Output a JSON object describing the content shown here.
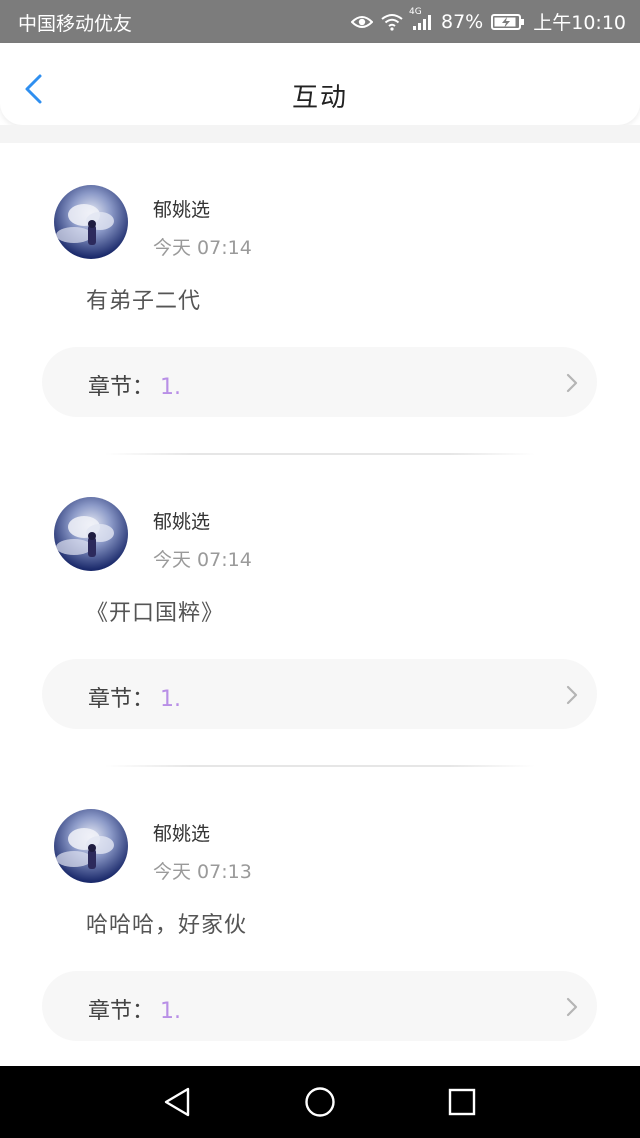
{
  "status_bar": {
    "carrier": "中国移动优友",
    "network": "4G",
    "battery": "87%",
    "time": "上午10:10"
  },
  "header": {
    "title": "互动",
    "back_icon": "chevron-left-icon"
  },
  "posts": [
    {
      "username": "郁姚选",
      "time": "今天 07:14",
      "content": "有弟子二代",
      "chapter_label": "章节：",
      "chapter_value": "1."
    },
    {
      "username": "郁姚选",
      "time": "今天 07:14",
      "content": "《开口国粹》",
      "chapter_label": "章节：",
      "chapter_value": "1."
    },
    {
      "username": "郁姚选",
      "time": "今天 07:13",
      "content": "哈哈哈，好家伙",
      "chapter_label": "章节：",
      "chapter_value": "1."
    }
  ],
  "nav_bar": {
    "back_icon": "triangle-back-icon",
    "home_icon": "circle-home-icon",
    "recents_icon": "square-recents-icon"
  },
  "colors": {
    "accent": "#2f8ff0",
    "chapter_value": "#b88fe6",
    "status_bar": "#7c7c7c"
  }
}
